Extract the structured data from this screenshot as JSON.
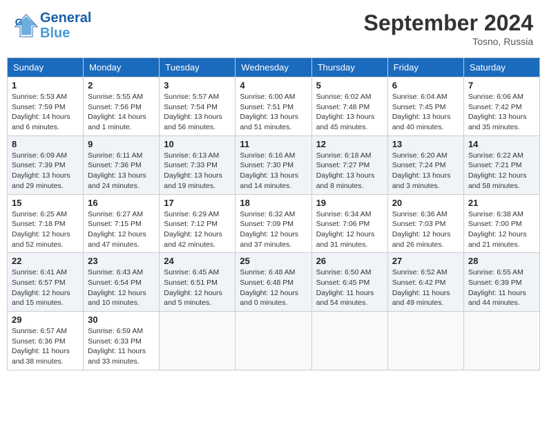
{
  "header": {
    "logo_line1": "General",
    "logo_line2": "Blue",
    "month_title": "September 2024",
    "location": "Tosno, Russia"
  },
  "days_of_week": [
    "Sunday",
    "Monday",
    "Tuesday",
    "Wednesday",
    "Thursday",
    "Friday",
    "Saturday"
  ],
  "weeks": [
    [
      {
        "day": "1",
        "sunrise": "5:53 AM",
        "sunset": "7:59 PM",
        "daylight": "14 hours and 6 minutes."
      },
      {
        "day": "2",
        "sunrise": "5:55 AM",
        "sunset": "7:56 PM",
        "daylight": "14 hours and 1 minute."
      },
      {
        "day": "3",
        "sunrise": "5:57 AM",
        "sunset": "7:54 PM",
        "daylight": "13 hours and 56 minutes."
      },
      {
        "day": "4",
        "sunrise": "6:00 AM",
        "sunset": "7:51 PM",
        "daylight": "13 hours and 51 minutes."
      },
      {
        "day": "5",
        "sunrise": "6:02 AM",
        "sunset": "7:48 PM",
        "daylight": "13 hours and 45 minutes."
      },
      {
        "day": "6",
        "sunrise": "6:04 AM",
        "sunset": "7:45 PM",
        "daylight": "13 hours and 40 minutes."
      },
      {
        "day": "7",
        "sunrise": "6:06 AM",
        "sunset": "7:42 PM",
        "daylight": "13 hours and 35 minutes."
      }
    ],
    [
      {
        "day": "8",
        "sunrise": "6:09 AM",
        "sunset": "7:39 PM",
        "daylight": "13 hours and 29 minutes."
      },
      {
        "day": "9",
        "sunrise": "6:11 AM",
        "sunset": "7:36 PM",
        "daylight": "13 hours and 24 minutes."
      },
      {
        "day": "10",
        "sunrise": "6:13 AM",
        "sunset": "7:33 PM",
        "daylight": "13 hours and 19 minutes."
      },
      {
        "day": "11",
        "sunrise": "6:16 AM",
        "sunset": "7:30 PM",
        "daylight": "13 hours and 14 minutes."
      },
      {
        "day": "12",
        "sunrise": "6:18 AM",
        "sunset": "7:27 PM",
        "daylight": "13 hours and 8 minutes."
      },
      {
        "day": "13",
        "sunrise": "6:20 AM",
        "sunset": "7:24 PM",
        "daylight": "13 hours and 3 minutes."
      },
      {
        "day": "14",
        "sunrise": "6:22 AM",
        "sunset": "7:21 PM",
        "daylight": "12 hours and 58 minutes."
      }
    ],
    [
      {
        "day": "15",
        "sunrise": "6:25 AM",
        "sunset": "7:18 PM",
        "daylight": "12 hours and 52 minutes."
      },
      {
        "day": "16",
        "sunrise": "6:27 AM",
        "sunset": "7:15 PM",
        "daylight": "12 hours and 47 minutes."
      },
      {
        "day": "17",
        "sunrise": "6:29 AM",
        "sunset": "7:12 PM",
        "daylight": "12 hours and 42 minutes."
      },
      {
        "day": "18",
        "sunrise": "6:32 AM",
        "sunset": "7:09 PM",
        "daylight": "12 hours and 37 minutes."
      },
      {
        "day": "19",
        "sunrise": "6:34 AM",
        "sunset": "7:06 PM",
        "daylight": "12 hours and 31 minutes."
      },
      {
        "day": "20",
        "sunrise": "6:36 AM",
        "sunset": "7:03 PM",
        "daylight": "12 hours and 26 minutes."
      },
      {
        "day": "21",
        "sunrise": "6:38 AM",
        "sunset": "7:00 PM",
        "daylight": "12 hours and 21 minutes."
      }
    ],
    [
      {
        "day": "22",
        "sunrise": "6:41 AM",
        "sunset": "6:57 PM",
        "daylight": "12 hours and 15 minutes."
      },
      {
        "day": "23",
        "sunrise": "6:43 AM",
        "sunset": "6:54 PM",
        "daylight": "12 hours and 10 minutes."
      },
      {
        "day": "24",
        "sunrise": "6:45 AM",
        "sunset": "6:51 PM",
        "daylight": "12 hours and 5 minutes."
      },
      {
        "day": "25",
        "sunrise": "6:48 AM",
        "sunset": "6:48 PM",
        "daylight": "12 hours and 0 minutes."
      },
      {
        "day": "26",
        "sunrise": "6:50 AM",
        "sunset": "6:45 PM",
        "daylight": "11 hours and 54 minutes."
      },
      {
        "day": "27",
        "sunrise": "6:52 AM",
        "sunset": "6:42 PM",
        "daylight": "11 hours and 49 minutes."
      },
      {
        "day": "28",
        "sunrise": "6:55 AM",
        "sunset": "6:39 PM",
        "daylight": "11 hours and 44 minutes."
      }
    ],
    [
      {
        "day": "29",
        "sunrise": "6:57 AM",
        "sunset": "6:36 PM",
        "daylight": "11 hours and 38 minutes."
      },
      {
        "day": "30",
        "sunrise": "6:59 AM",
        "sunset": "6:33 PM",
        "daylight": "11 hours and 33 minutes."
      },
      null,
      null,
      null,
      null,
      null
    ]
  ]
}
